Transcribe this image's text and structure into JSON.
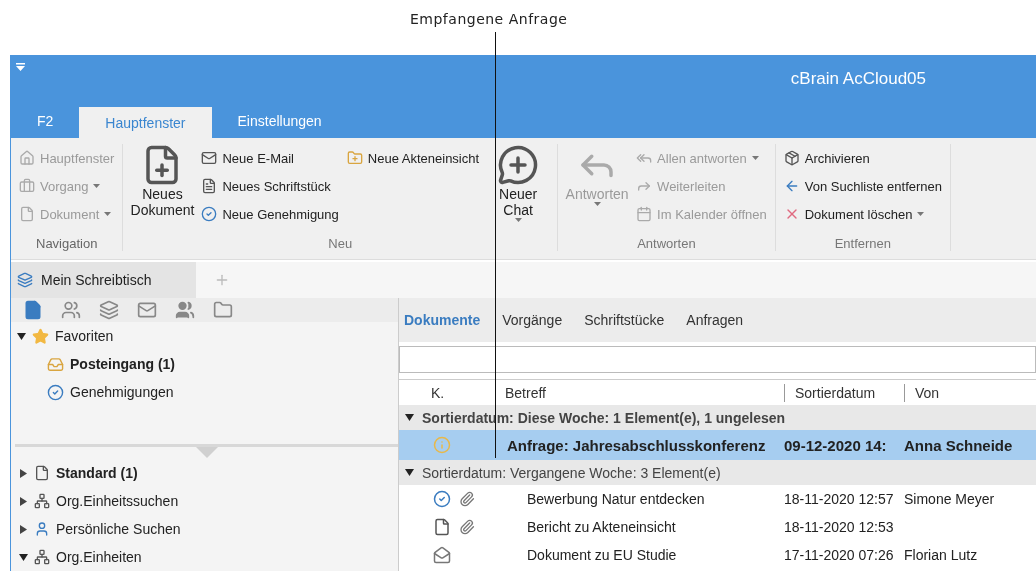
{
  "annotation": {
    "label": "Empfangene Anfrage"
  },
  "window": {
    "title": "cBrain AcCloud05"
  },
  "tabs": [
    {
      "label": "F2",
      "selected": false
    },
    {
      "label": "Hauptfenster",
      "selected": true
    },
    {
      "label": "Einstellungen",
      "selected": false
    }
  ],
  "ribbon": [
    {
      "label": "Navigation",
      "disabled": true,
      "columns": [
        [
          {
            "kind": "small",
            "label": "Hauptfenster",
            "disabled": true,
            "dropdown": false
          },
          {
            "kind": "small",
            "label": "Vorgang",
            "disabled": true,
            "dropdown": true
          },
          {
            "kind": "small",
            "label": "Dokument",
            "disabled": true,
            "dropdown": true
          }
        ]
      ]
    },
    {
      "label": "Neu",
      "disabled": false,
      "columns": [
        [
          {
            "kind": "large",
            "label": "Neues Dokument",
            "disabled": false,
            "dropdown": false
          }
        ],
        [
          {
            "kind": "small",
            "label": "Neue E-Mail",
            "disabled": false,
            "dropdown": false
          },
          {
            "kind": "small",
            "label": "Neues Schriftstück",
            "disabled": false,
            "dropdown": false
          },
          {
            "kind": "small",
            "label": "Neue Genehmigung",
            "disabled": false,
            "dropdown": false
          }
        ],
        [
          {
            "kind": "small",
            "label": "Neue Akteneinsicht",
            "disabled": false,
            "dropdown": false
          }
        ],
        [
          {
            "kind": "large",
            "label": "Neuer Chat",
            "disabled": false,
            "dropdown": true
          }
        ]
      ]
    },
    {
      "label": "Antworten",
      "disabled": false,
      "columns": [
        [
          {
            "kind": "large",
            "label": "Antworten",
            "disabled": true,
            "dropdown": true
          }
        ],
        [
          {
            "kind": "small",
            "label": "Allen antworten",
            "disabled": true,
            "dropdown": true
          },
          {
            "kind": "small",
            "label": "Weiterleiten",
            "disabled": true,
            "dropdown": false
          },
          {
            "kind": "small",
            "label": "Im Kalender öffnen",
            "disabled": true,
            "dropdown": false
          }
        ]
      ]
    },
    {
      "label": "Entfernen",
      "disabled": false,
      "columns": [
        [
          {
            "kind": "small",
            "label": "Archivieren",
            "disabled": false,
            "dropdown": false
          },
          {
            "kind": "small",
            "label": "Von Suchliste entfernen",
            "disabled": false,
            "dropdown": false
          },
          {
            "kind": "small",
            "label": "Dokument löschen",
            "disabled": false,
            "dropdown": true
          }
        ]
      ]
    }
  ],
  "doc_tabs": [
    {
      "label": "Mein Schreibtisch",
      "selected": true
    }
  ],
  "favorites": {
    "label": "Favoriten",
    "expanded": true,
    "children": [
      {
        "label": "Posteingang (1)",
        "bold": true
      },
      {
        "label": "Genehmigungen",
        "bold": false
      }
    ]
  },
  "search_trees": [
    {
      "label": "Standard (1)",
      "bold": true,
      "expanded": false
    },
    {
      "label": "Org.Einheitssuchen",
      "bold": false,
      "expanded": false
    },
    {
      "label": "Persönliche Suchen",
      "bold": false,
      "expanded": false
    },
    {
      "label": "Org.Einheiten",
      "bold": false,
      "expanded": true
    }
  ],
  "list_tabs": [
    {
      "label": "Dokumente",
      "selected": true
    },
    {
      "label": "Vorgänge",
      "selected": false
    },
    {
      "label": "Schriftstücke",
      "selected": false
    },
    {
      "label": "Anfragen",
      "selected": false
    }
  ],
  "columns": [
    "K.",
    "Betreff",
    "Sortierdatum",
    "Von"
  ],
  "groups": [
    {
      "label": "Sortierdatum: Diese Woche: 1 Element(e), 1 ungelesen",
      "bold": true,
      "expanded": true,
      "rows": [
        {
          "kind": "request",
          "attachment": false,
          "subject": "Anfrage: Jahresabschlusskonferenz",
          "date": "09-12-2020 14:",
          "from": "Anna Schneide",
          "selected": true,
          "unread": true
        }
      ]
    },
    {
      "label": "Sortierdatum: Vergangene Woche: 3 Element(e)",
      "bold": false,
      "expanded": true,
      "rows": [
        {
          "kind": "approval",
          "attachment": true,
          "subject": "Bewerbung Natur entdecken",
          "date": "18-11-2020 12:57",
          "from": "Simone Meyer",
          "selected": false,
          "unread": false
        },
        {
          "kind": "document",
          "attachment": true,
          "subject": "Bericht zu Akteneinsicht",
          "date": "18-11-2020 12:53",
          "selected": false,
          "unread": false
        },
        {
          "kind": "mail",
          "attachment": false,
          "subject": "Dokument zu EU Studie",
          "date": "17-11-2020 07:26",
          "from": "Florian Lutz",
          "selected": false,
          "unread": false
        }
      ]
    }
  ]
}
